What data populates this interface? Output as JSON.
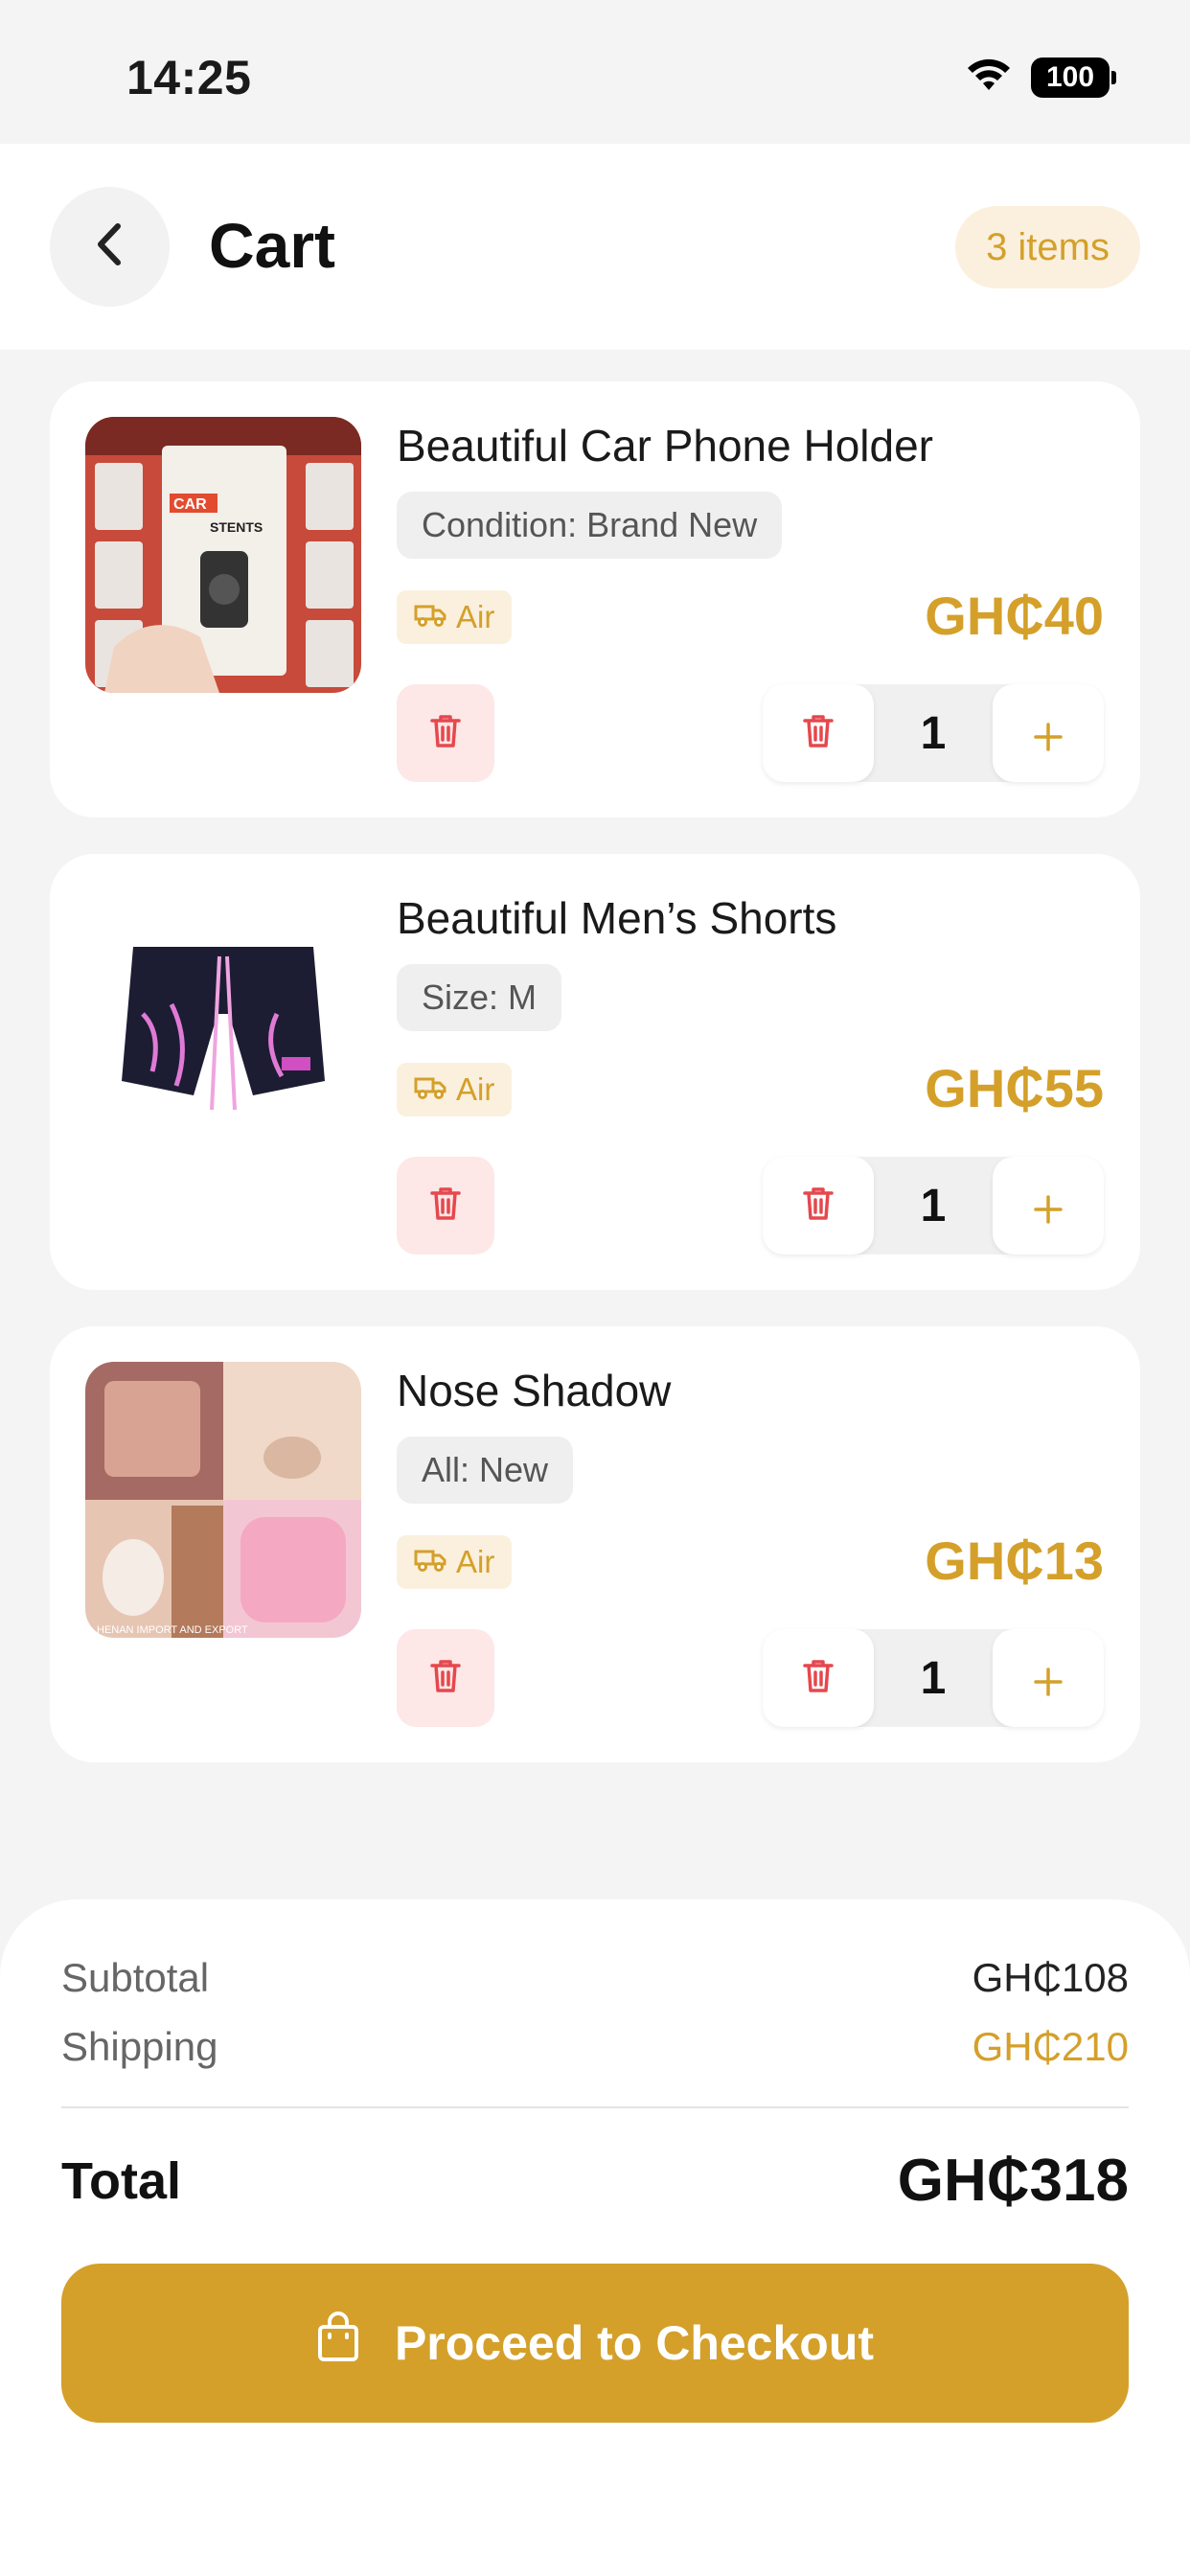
{
  "status": {
    "time": "14:25",
    "battery": "100"
  },
  "header": {
    "title": "Cart",
    "items_badge": "3 items"
  },
  "items": [
    {
      "name": "Beautiful Car Phone Holder",
      "tag": "Condition: Brand New",
      "shipping": "Air",
      "price": "GH₵40",
      "qty": "1",
      "image_brand_text": "CAR",
      "image_sub_text": "STENTS"
    },
    {
      "name": "Beautiful Men’s Shorts",
      "tag": "Size: M",
      "shipping": "Air",
      "price": "GH₵55",
      "qty": "1"
    },
    {
      "name": "Nose Shadow",
      "tag": "All: New",
      "shipping": "Air",
      "price": "GH₵13",
      "qty": "1",
      "image_watermark": "HENAN IMPORT AND EXPORT"
    }
  ],
  "summary": {
    "subtotal_label": "Subtotal",
    "subtotal_value": "GH₵108",
    "shipping_label": "Shipping",
    "shipping_value": "GH₵210",
    "total_label": "Total",
    "total_value": "GH₵318",
    "checkout_label": "Proceed to Checkout"
  },
  "colors": {
    "accent": "#d4a02a",
    "accent_soft": "#fbf0de",
    "danger": "#e5484d",
    "danger_soft": "#fde7e7",
    "background": "#f4f4f4"
  },
  "icons": {
    "back": "chevron-left-icon",
    "shipping": "truck-icon",
    "delete": "trash-icon",
    "plus": "plus-icon",
    "checkout": "shopping-bag-icon",
    "wifi": "wifi-icon",
    "battery": "battery-icon"
  }
}
